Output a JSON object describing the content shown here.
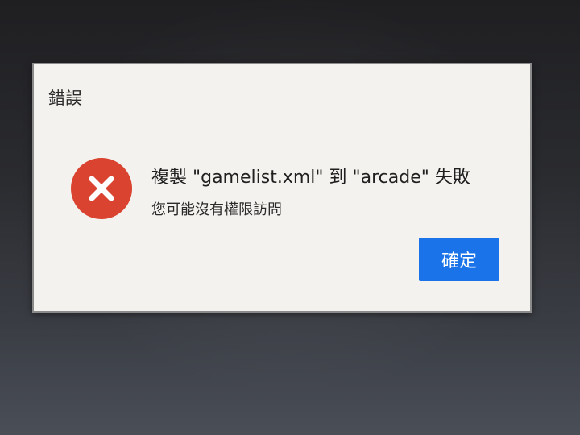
{
  "dialog": {
    "title": "錯誤",
    "icon": "error-x-icon",
    "icon_color": "#d9432f",
    "message": "複製 \"gamelist.xml\" 到 \"arcade\" 失敗",
    "submessage": "您可能沒有權限訪問",
    "ok_label": "確定",
    "button_color": "#1a73e8"
  }
}
